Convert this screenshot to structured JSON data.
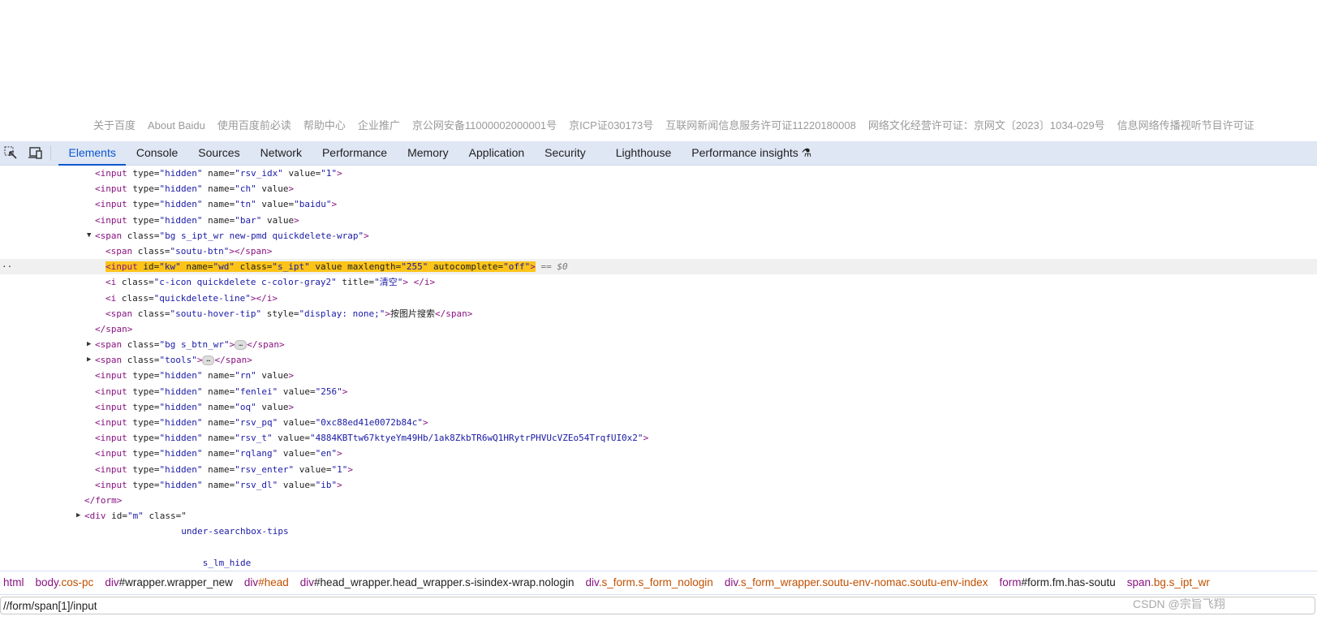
{
  "footer_links": [
    "关于百度",
    "About Baidu",
    "使用百度前必读",
    "帮助中心",
    "企业推广",
    "京公网安备11000002000001号",
    "京ICP证030173号",
    "互联网新闻信息服务许可证11220180008",
    "网络文化经营许可证：京网文〔2023〕1034-029号",
    "信息网络传播视听节目许可证"
  ],
  "devtools": {
    "icons": [
      "inspect-element-icon",
      "device-toolbar-icon"
    ],
    "tabs": [
      "Elements",
      "Console",
      "Sources",
      "Network",
      "Performance",
      "Memory",
      "Application",
      "Security",
      "Lighthouse",
      "Performance insights ⚗"
    ],
    "active_tab": "Elements",
    "accent_color": "#0b57d0",
    "highlight_color": "#fcc419",
    "code_lines": [
      {
        "indent": 1,
        "text": "<input type=\"hidden\" name=\"rsv_idx\" value=\"1\">"
      },
      {
        "indent": 1,
        "text": "<input type=\"hidden\" name=\"ch\" value>"
      },
      {
        "indent": 1,
        "text": "<input type=\"hidden\" name=\"tn\" value=\"baidu\">"
      },
      {
        "indent": 1,
        "text": "<input type=\"hidden\" name=\"bar\" value>"
      },
      {
        "indent": 1,
        "arrow": "▼",
        "text": "<span class=\"bg s_ipt_wr new-pmd quickdelete-wrap\">"
      },
      {
        "indent": 2,
        "text": "<span class=\"soutu-btn\"></span>"
      },
      {
        "indent": 2,
        "selected": true,
        "text": "<input id=\"kw\" name=\"wd\" class=\"s_ipt\" value maxlength=\"255\" autocomplete=\"off\">",
        "suffix": " == $0"
      },
      {
        "indent": 2,
        "text": "<i class=\"c-icon quickdelete c-color-gray2\" title=\"清空\"> </i>"
      },
      {
        "indent": 2,
        "text": "<i class=\"quickdelete-line\"></i>"
      },
      {
        "indent": 2,
        "text": "<span class=\"soutu-hover-tip\" style=\"display: none;\">按图片搜索</span>"
      },
      {
        "indent": 1,
        "text": "</span>"
      },
      {
        "indent": 1,
        "arrow": "▶",
        "text": "<span class=\"bg s_btn_wr\">",
        "collapsed": "…",
        "close": "</span>"
      },
      {
        "indent": 1,
        "arrow": "▶",
        "text": "<span class=\"tools\">",
        "collapsed": "…",
        "close": "</span>"
      },
      {
        "indent": 1,
        "text": "<input type=\"hidden\" name=\"rn\" value>"
      },
      {
        "indent": 1,
        "text": "<input type=\"hidden\" name=\"fenlei\" value=\"256\">"
      },
      {
        "indent": 1,
        "text": "<input type=\"hidden\" name=\"oq\" value>"
      },
      {
        "indent": 1,
        "text": "<input type=\"hidden\" name=\"rsv_pq\" value=\"0xc88ed41e0072b84c\">"
      },
      {
        "indent": 1,
        "text": "<input type=\"hidden\" name=\"rsv_t\" value=\"4884KBTtw67ktyeYm49Hb/1ak8ZkbTR6wQ1HRytrPHVUcVZEo54TrqfUI0x2\">"
      },
      {
        "indent": 1,
        "text": "<input type=\"hidden\" name=\"rqlang\" value=\"en\">"
      },
      {
        "indent": 1,
        "text": "<input type=\"hidden\" name=\"rsv_enter\" value=\"1\">"
      },
      {
        "indent": 1,
        "text": "<input type=\"hidden\" name=\"rsv_dl\" value=\"ib\">"
      },
      {
        "indent": 0,
        "text": "</form>"
      },
      {
        "indent": 0,
        "arrow": "▶",
        "text": "<div id=\"m\" class=\""
      },
      {
        "indent": 0,
        "plain": "                  under-searchbox-tips"
      },
      {
        "indent": 0,
        "plain": ""
      },
      {
        "indent": 0,
        "plain": "                      s_lm_hide"
      }
    ]
  },
  "breadcrumbs": [
    {
      "tag": "html",
      "rest": "",
      "style": "a"
    },
    {
      "tag": "body",
      "rest": ".cos-pc",
      "style": "a"
    },
    {
      "tag": "div",
      "rest": "#wrapper.wrapper_new",
      "style": "b"
    },
    {
      "tag": "div",
      "rest": "#head",
      "style": "a"
    },
    {
      "tag": "div",
      "rest": "#head_wrapper.head_wrapper.s-isindex-wrap.nologin",
      "style": "b"
    },
    {
      "tag": "div",
      "rest": ".s_form.s_form_nologin",
      "style": "a"
    },
    {
      "tag": "div",
      "rest": ".s_form_wrapper.soutu-env-nomac.soutu-env-index",
      "style": "a"
    },
    {
      "tag": "form",
      "rest": "#form.fm.has-soutu",
      "style": "b"
    },
    {
      "tag": "span",
      "rest": ".bg.s_ipt_wr",
      "style": "a"
    }
  ],
  "search": {
    "value": "//form/span[1]/input"
  },
  "watermark": "CSDN @宗旨飞翔"
}
